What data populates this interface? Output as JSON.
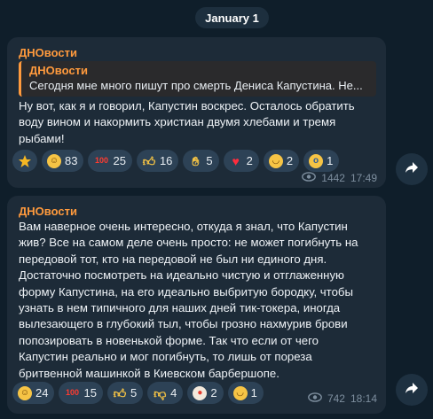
{
  "date_label": "January 1",
  "messages": [
    {
      "sender": "ДНОвости",
      "quote": {
        "name": "ДНОвости",
        "text": "Сегодня мне много пишут про смерть Дениса Капустина. Не..."
      },
      "text": "Ну вот, как я и говорил, Капустин воскрес. Осталось обратить\nводу вином и накормить христиан двумя хлебами и тремя\nрыбами!",
      "reactions": [
        {
          "icon": "star-icon",
          "count": ""
        },
        {
          "icon": "rofl-emoji-icon",
          "count": "83"
        },
        {
          "icon": "hundred-emoji-icon",
          "count": "25"
        },
        {
          "icon": "thumbs-up-emoji-icon",
          "count": "16"
        },
        {
          "icon": "clap-emoji-icon",
          "count": "5"
        },
        {
          "icon": "heart-emoji-icon",
          "count": "2"
        },
        {
          "icon": "grin-emoji-icon",
          "count": "2"
        },
        {
          "icon": "scream-emoji-icon",
          "count": "1"
        }
      ],
      "views": "1442",
      "time": "17:49"
    },
    {
      "sender": "ДНОвости",
      "text": "Вам наверное очень интересно, откуда я знал, что Капустин\nжив? Все на самом деле очень просто: не может погибнуть на\nпередовой тот, кто на передовой не был ни единого дня.\nДостаточно посмотреть на идеально чистую и отглаженную\nформу Капустина, на его идеально выбритую бородку, чтобы\nузнать в нем типичного для наших дней тик-токера, иногда\nвылезающего в глубокий тыл, чтобы грозно нахмурив брови\nпопозировать в новенькой форме. Так что если от чего\nКапустин реально и мог погибнуть, то лишь от пореза\nбритвенной машинкой в Киевском барбершопе.",
      "reactions": [
        {
          "icon": "rofl-emoji-icon",
          "count": "24"
        },
        {
          "icon": "hundred-emoji-icon",
          "count": "15"
        },
        {
          "icon": "thumbs-up-emoji-icon",
          "count": "5"
        },
        {
          "icon": "thumbs-down-emoji-icon",
          "count": "4"
        },
        {
          "icon": "clown-emoji-icon",
          "count": "2"
        },
        {
          "icon": "grin-emoji-icon",
          "count": "1"
        }
      ],
      "views": "742",
      "time": "18:14"
    }
  ],
  "colors": {
    "background": "#0f1e2a",
    "bubble": "#1d2b38",
    "accent": "#ff9a3d",
    "reaction_pill": "#2d4256",
    "meta": "#7d8e9e"
  }
}
